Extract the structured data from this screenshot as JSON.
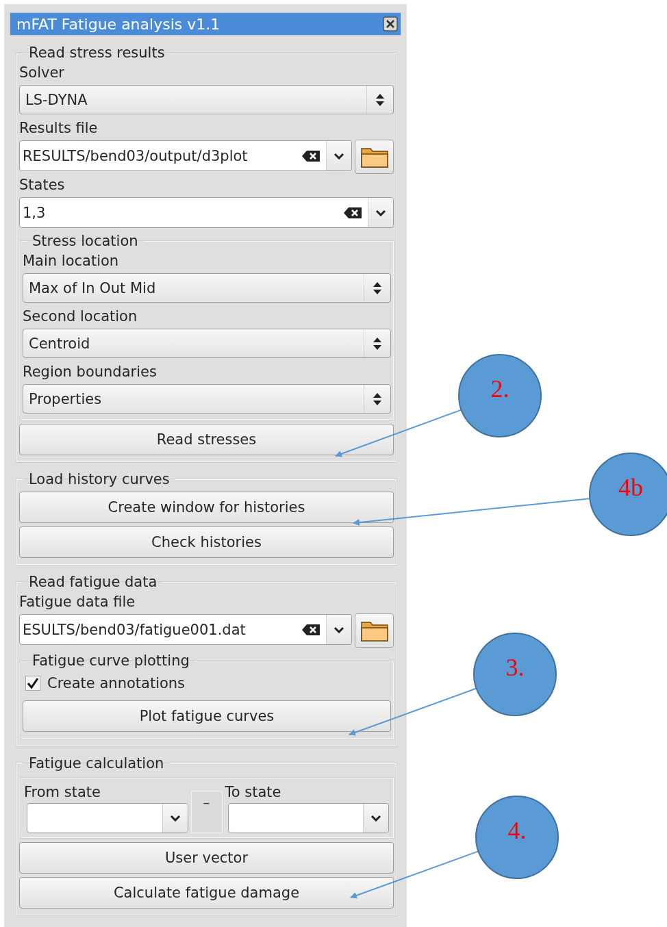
{
  "window": {
    "title": "mFAT Fatigue analysis v1.1"
  },
  "sections": [
    {
      "title": "Read stress results",
      "items": [
        {
          "kind": "label",
          "text": "Solver"
        },
        {
          "kind": "combo",
          "value": "LS-DYNA"
        },
        {
          "kind": "label",
          "text": "Results file"
        },
        {
          "kind": "file",
          "value": "RESULTS/bend03/output/d3plot"
        },
        {
          "kind": "label",
          "text": "States"
        },
        {
          "kind": "entry",
          "value": "1,3"
        },
        {
          "kind": "group",
          "title": "Stress location",
          "items": [
            {
              "kind": "label",
              "text": "Main location"
            },
            {
              "kind": "combo",
              "value": "Max of In Out Mid"
            },
            {
              "kind": "label",
              "text": "Second location"
            },
            {
              "kind": "combo",
              "value": "Centroid"
            },
            {
              "kind": "label",
              "text": "Region boundaries"
            },
            {
              "kind": "combo",
              "value": "Properties"
            }
          ]
        },
        {
          "kind": "button",
          "label": "Read stresses"
        }
      ]
    },
    {
      "title": "Load history curves",
      "items": [
        {
          "kind": "button",
          "label": "Create window for histories"
        },
        {
          "kind": "button",
          "label": "Check histories"
        }
      ]
    },
    {
      "title": "Read fatigue data",
      "items": [
        {
          "kind": "label",
          "text": "Fatigue data file"
        },
        {
          "kind": "file",
          "value": "ESULTS/bend03/fatigue001.dat"
        },
        {
          "kind": "group",
          "title": "Fatigue curve plotting",
          "items": [
            {
              "kind": "checkbox",
              "label": "Create annotations",
              "checked": true
            },
            {
              "kind": "button",
              "label": "Plot fatigue curves"
            }
          ]
        }
      ]
    },
    {
      "title": "Fatigue calculation",
      "items": [
        {
          "kind": "range",
          "from_label": "From state",
          "separator": "–",
          "to_label": "To state"
        },
        {
          "kind": "button",
          "label": "User vector"
        },
        {
          "kind": "button",
          "label": "Calculate fatigue damage"
        }
      ]
    }
  ],
  "callouts": [
    {
      "label": "2."
    },
    {
      "label": "4b"
    },
    {
      "label": "3."
    },
    {
      "label": "4."
    }
  ]
}
